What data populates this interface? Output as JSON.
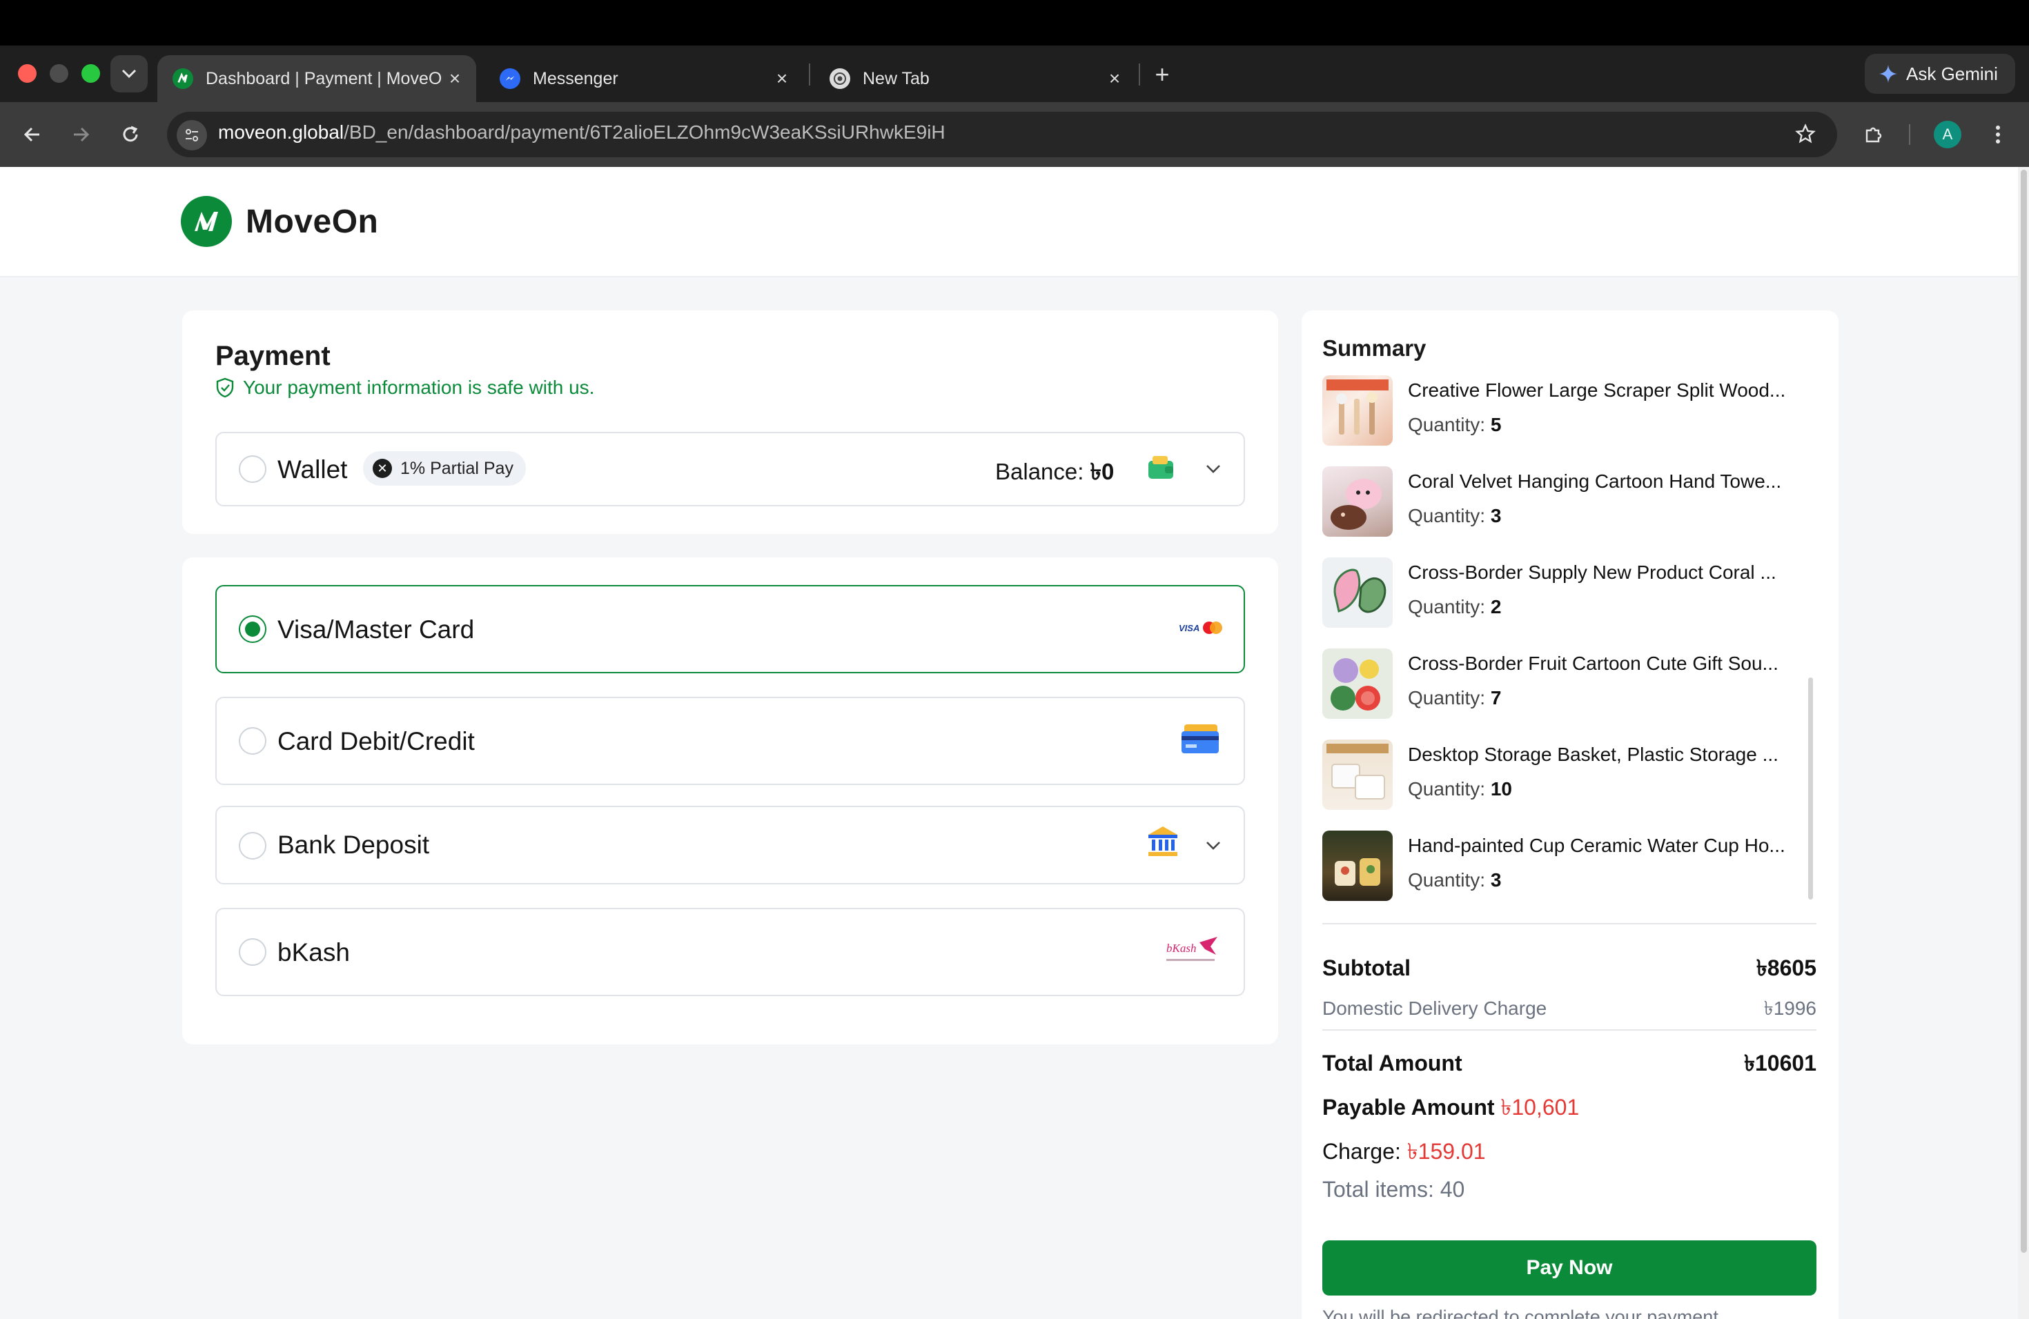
{
  "browser": {
    "tabs": [
      {
        "title": "Dashboard | Payment | MoveOn",
        "active": true
      },
      {
        "title": "Messenger",
        "active": false
      },
      {
        "title": "New Tab",
        "active": false
      }
    ],
    "gemini_label": "Ask Gemini",
    "url_host": "moveon.global",
    "url_path": "/BD_en/dashboard/payment/6T2alioELZOhm9cW3eaKSsiURhwkE9iH",
    "profile_initial": "A"
  },
  "brand": {
    "name": "MoveOn",
    "color": "#0b8a3a"
  },
  "payment": {
    "title": "Payment",
    "safe_note": "Your payment information is safe with us.",
    "wallet": {
      "label": "Wallet",
      "badge": "1% Partial Pay",
      "balance_label": "Balance:",
      "balance_value": "৳0"
    },
    "methods": [
      {
        "label": "Visa/Master Card",
        "selected": true,
        "icon": "visa-mastercard-icon"
      },
      {
        "label": "Card Debit/Credit",
        "selected": false,
        "icon": "credit-card-icon"
      },
      {
        "label": "Bank Deposit",
        "selected": false,
        "icon": "bank-icon"
      },
      {
        "label": "bKash",
        "selected": false,
        "icon": "bkash-logo"
      }
    ]
  },
  "summary": {
    "title": "Summary",
    "qty_label": "Quantity:",
    "items": [
      {
        "name": "Creative Flower Large Scraper Split Wood...",
        "quantity": "5"
      },
      {
        "name": "Coral Velvet Hanging Cartoon Hand Towe...",
        "quantity": "3"
      },
      {
        "name": "Cross-Border Supply New Product Coral ...",
        "quantity": "2"
      },
      {
        "name": "Cross-Border Fruit Cartoon Cute Gift Sou...",
        "quantity": "7"
      },
      {
        "name": "Desktop Storage Basket, Plastic Storage ...",
        "quantity": "10"
      },
      {
        "name": "Hand-painted Cup Ceramic Water Cup Ho...",
        "quantity": "3"
      }
    ],
    "subtotal_label": "Subtotal",
    "subtotal_value": "৳8605",
    "delivery_label": "Domestic Delivery Charge",
    "delivery_value": "৳1996",
    "total_label": "Total Amount",
    "total_value": "৳10601",
    "payable_label": "Payable Amount",
    "payable_value": "৳10,601",
    "charge_label": "Charge:",
    "charge_value": "৳159.01",
    "total_items": "Total items: 40",
    "pay_button": "Pay Now",
    "redirect_note": "You will be redirected to complete your payment"
  }
}
